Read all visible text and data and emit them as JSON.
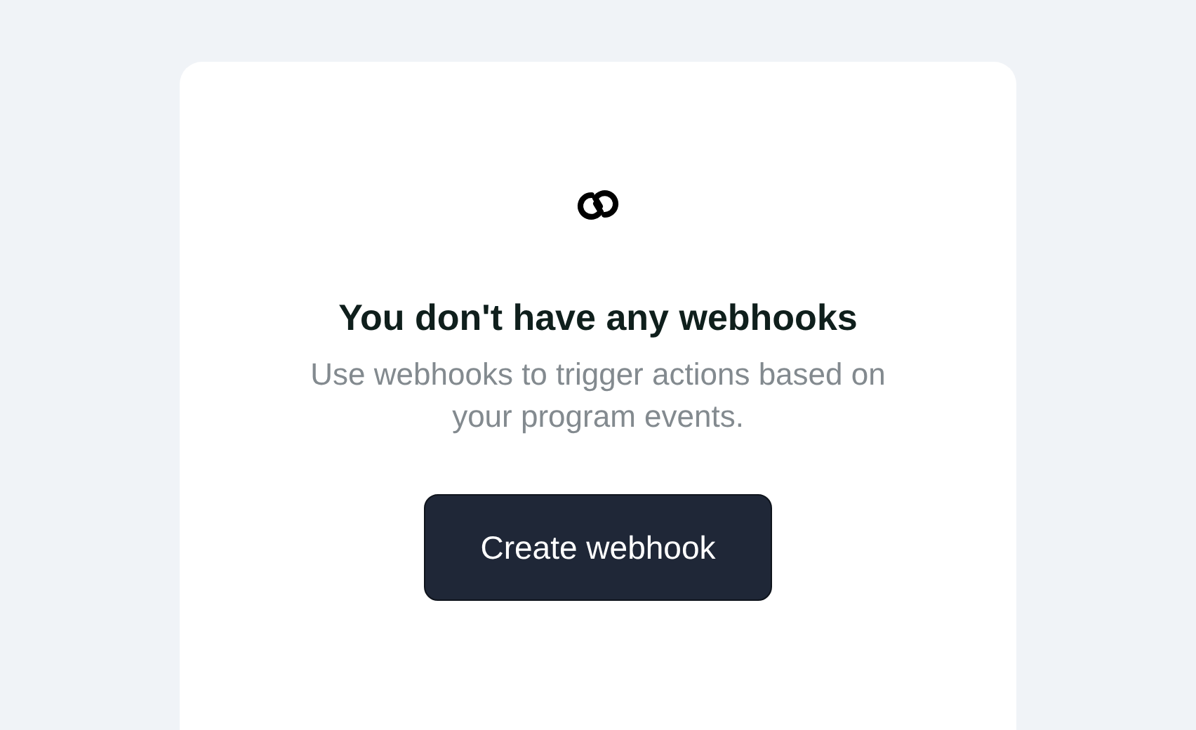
{
  "empty_state": {
    "title": "You don't have any webhooks",
    "description": "Use webhooks to trigger actions based on your program events.",
    "button": "Create webhook"
  }
}
